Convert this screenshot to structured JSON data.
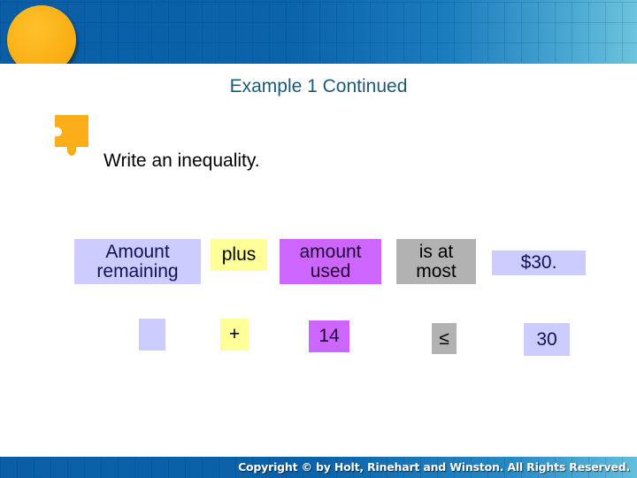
{
  "header": {
    "icon": "sun-circle-icon"
  },
  "slide": {
    "title": "Example 1 Continued",
    "step_icon": "puzzle-piece-icon",
    "instruction": "Write an inequality."
  },
  "phrases": [
    {
      "text_line1": "Amount",
      "text_line2": "remaining",
      "color": "#ccccff"
    },
    {
      "text_line1": "plus",
      "text_line2": "",
      "color": "#ffff99"
    },
    {
      "text_line1": "amount",
      "text_line2": "used",
      "color": "#cc66ff"
    },
    {
      "text_line1": "is at",
      "text_line2": "most",
      "color": "#b2b2b2"
    },
    {
      "text_line1": "$30.",
      "text_line2": "",
      "color": "#ccccff"
    }
  ],
  "symbols": [
    {
      "text": "",
      "color": "#ccccff"
    },
    {
      "text": "+",
      "color": "#ffff99"
    },
    {
      "text": "14",
      "color": "#cc66ff"
    },
    {
      "text": "≤",
      "color": "#b2b2b2"
    },
    {
      "text": "30",
      "color": "#ccccff"
    }
  ],
  "footer": {
    "copyright": "Copyright © by Holt, Rinehart and Winston. All Rights Reserved."
  }
}
